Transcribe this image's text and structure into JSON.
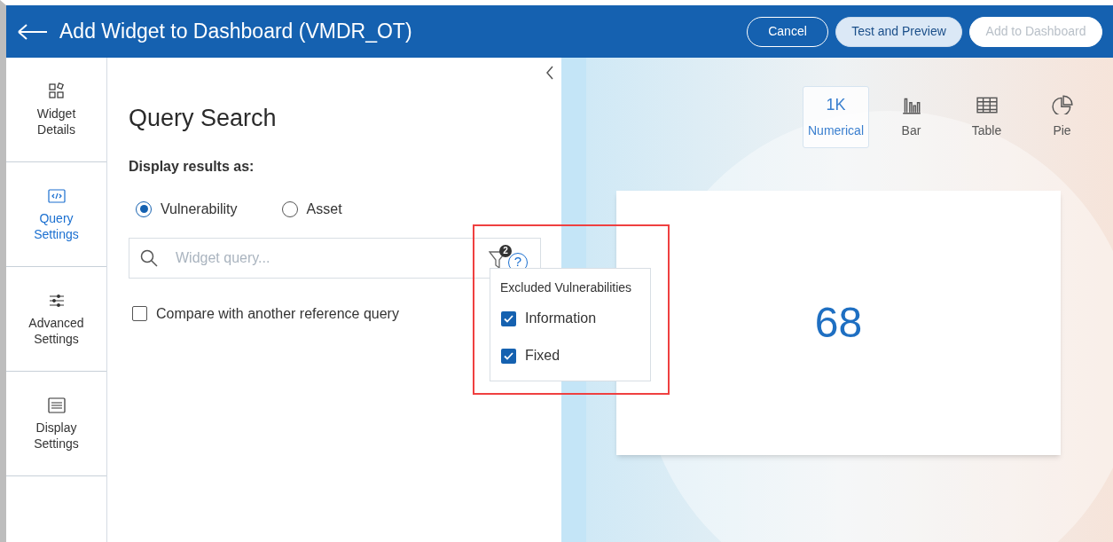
{
  "header": {
    "title": "Add Widget to Dashboard (VMDR_OT)",
    "buttons": [
      {
        "label": "Cancel",
        "kind": "outline",
        "disabled": false
      },
      {
        "label": "Test and Preview",
        "kind": "light",
        "disabled": false
      },
      {
        "label": "Add to Dashboard",
        "kind": "light",
        "disabled": true
      }
    ]
  },
  "sidebar": {
    "items": [
      {
        "label": "Widget Details",
        "kind": "widgets",
        "selected": false
      },
      {
        "label": "Query Settings",
        "kind": "code",
        "selected": true
      },
      {
        "label": "Advanced Settings",
        "kind": "sliders",
        "selected": false
      },
      {
        "label": "Display Settings",
        "kind": "display",
        "selected": false
      }
    ]
  },
  "query": {
    "title": "Query Search",
    "display_label": "Display results as:",
    "options": [
      {
        "label": "Vulnerability",
        "selected": true
      },
      {
        "label": "Asset",
        "selected": false
      }
    ],
    "search": {
      "placeholder": "Widget query..."
    },
    "filter_badge": "2",
    "help": "?",
    "compare": {
      "label": "Compare with another reference query",
      "checked": false
    }
  },
  "filter_popup": {
    "title": "Excluded Vulnerabilities",
    "items": [
      {
        "label": "Information",
        "checked": true
      },
      {
        "label": "Fixed",
        "checked": true
      }
    ]
  },
  "preview": {
    "types": [
      {
        "label": "Numerical",
        "glyph": "1K",
        "kind": "number",
        "selected": true
      },
      {
        "label": "Bar",
        "kind": "bar",
        "selected": false
      },
      {
        "label": "Table",
        "kind": "table",
        "selected": false
      },
      {
        "label": "Pie",
        "kind": "pie",
        "selected": false
      }
    ],
    "value": "68"
  }
}
